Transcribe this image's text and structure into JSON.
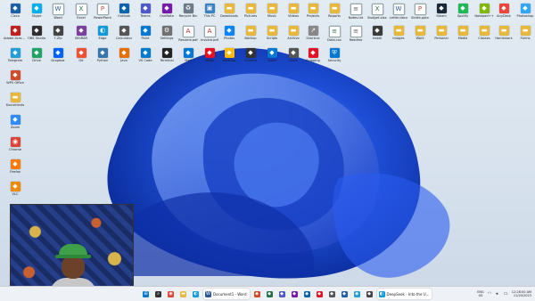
{
  "wallpaper": {
    "name": "Windows 11 Bloom",
    "primary": "#1e4fd8",
    "secondary": "#0b2c9a",
    "highlight": "#6aa0ff",
    "background": "#dde6f0"
  },
  "desktop_icons": [
    {
      "label": "Cisco",
      "icon": "app-icon",
      "kind": "exe",
      "color": "#1b5fa7"
    },
    {
      "label": "Adobe Acrobat",
      "icon": "app-icon",
      "kind": "exe",
      "color": "#c21f1f"
    },
    {
      "label": "Telegram",
      "icon": "app-icon",
      "kind": "exe",
      "color": "#229ed9"
    },
    {
      "label": "WPS Office",
      "icon": "app-icon",
      "kind": "exe",
      "color": "#d24b28"
    },
    {
      "label": "Documents",
      "icon": "folder-icon",
      "kind": "folder",
      "color": "#e8b83a"
    },
    {
      "label": "Zoom",
      "icon": "app-icon",
      "kind": "exe",
      "color": "#2d8cff"
    },
    {
      "label": "Chrome",
      "icon": "chrome-icon",
      "kind": "exe",
      "color": "#de4335"
    },
    {
      "label": "Firefox",
      "icon": "app-icon",
      "kind": "exe",
      "color": "#ff7a00"
    },
    {
      "label": "VLC",
      "icon": "app-icon",
      "kind": "exe",
      "color": "#f08a00"
    },
    {
      "label": "Skype",
      "icon": "app-icon",
      "kind": "exe",
      "color": "#00aff0"
    },
    {
      "label": "Word",
      "icon": "word-icon",
      "kind": "file",
      "color": "#2b579a"
    },
    {
      "label": "Excel",
      "icon": "excel-icon",
      "kind": "file",
      "color": "#217346"
    },
    {
      "label": "PowerPoint",
      "icon": "ppt-icon",
      "kind": "file",
      "color": "#d24726"
    },
    {
      "label": "Outlook",
      "icon": "app-icon",
      "kind": "exe",
      "color": "#0a64ad"
    },
    {
      "label": "Teams",
      "icon": "app-icon",
      "kind": "exe",
      "color": "#5059c9"
    },
    {
      "label": "OneNote",
      "icon": "app-icon",
      "kind": "exe",
      "color": "#7719aa"
    },
    {
      "label": "Recycle Bin",
      "icon": "recycle-bin-icon",
      "kind": "exe",
      "color": "#6d7a8a"
    },
    {
      "label": "This PC",
      "icon": "computer-icon",
      "kind": "exe",
      "color": "#3a82c4"
    },
    {
      "label": "Downloads",
      "icon": "folder-icon",
      "kind": "folder",
      "color": "#e8b83a"
    },
    {
      "label": "Pictures",
      "icon": "folder-icon",
      "kind": "folder",
      "color": "#e8b83a"
    },
    {
      "label": "Music",
      "icon": "folder-icon",
      "kind": "folder",
      "color": "#e8b83a"
    },
    {
      "label": "Videos",
      "icon": "folder-icon",
      "kind": "folder",
      "color": "#e8b83a"
    },
    {
      "label": "Projects",
      "icon": "folder-icon",
      "kind": "folder",
      "color": "#e8b83a"
    },
    {
      "label": "Reports",
      "icon": "folder-icon",
      "kind": "folder",
      "color": "#e8b83a"
    },
    {
      "label": "Notes.txt",
      "icon": "file-icon",
      "kind": "file",
      "color": "#5a5a5a"
    },
    {
      "label": "Budget.xlsx",
      "icon": "excel-icon",
      "kind": "file",
      "color": "#217346"
    },
    {
      "label": "Letter.docx",
      "icon": "word-icon",
      "kind": "file",
      "color": "#2b579a"
    },
    {
      "label": "Slides.pptx",
      "icon": "ppt-icon",
      "kind": "file",
      "color": "#d24726"
    },
    {
      "label": "Steam",
      "icon": "app-icon",
      "kind": "exe",
      "color": "#1b2838"
    },
    {
      "label": "Spotify",
      "icon": "app-icon",
      "kind": "exe",
      "color": "#1db954"
    },
    {
      "label": "Notepad++",
      "icon": "app-icon",
      "kind": "exe",
      "color": "#7fb900"
    },
    {
      "label": "AnyDesk",
      "icon": "app-icon",
      "kind": "exe",
      "color": "#ef443b"
    },
    {
      "label": "Photoshop",
      "icon": "app-icon",
      "kind": "exe",
      "color": "#31a8ff"
    },
    {
      "label": "OBS Studio",
      "icon": "app-icon",
      "kind": "exe",
      "color": "#302e31"
    },
    {
      "label": "7-Zip",
      "icon": "app-icon",
      "kind": "exe",
      "color": "#444"
    },
    {
      "label": "WinRAR",
      "icon": "app-icon",
      "kind": "exe",
      "color": "#7b3fa0"
    },
    {
      "label": "Edge",
      "icon": "edge-icon",
      "kind": "exe",
      "color": "#0c9bdb"
    },
    {
      "label": "Calculator",
      "icon": "app-icon",
      "kind": "exe",
      "color": "#555"
    },
    {
      "label": "Paint",
      "icon": "app-icon",
      "kind": "exe",
      "color": "#0078d4"
    },
    {
      "label": "Settings",
      "icon": "gear-icon",
      "kind": "exe",
      "color": "#707070"
    },
    {
      "label": "Resume.pdf",
      "icon": "pdf-icon",
      "kind": "file",
      "color": "#c21f1f"
    },
    {
      "label": "Invoice.pdf",
      "icon": "pdf-icon",
      "kind": "file",
      "color": "#c21f1f"
    },
    {
      "label": "Photos",
      "icon": "app-icon",
      "kind": "exe",
      "color": "#0a84ff"
    },
    {
      "label": "Backup",
      "icon": "folder-icon",
      "kind": "folder",
      "color": "#e8b83a"
    },
    {
      "label": "Scripts",
      "icon": "folder-icon",
      "kind": "folder",
      "color": "#e8b83a"
    },
    {
      "label": "Archive",
      "icon": "folder-icon",
      "kind": "folder",
      "color": "#e8b83a"
    },
    {
      "label": "Shortcut",
      "icon": "link-icon",
      "kind": "exe",
      "color": "#888"
    },
    {
      "label": "Data.csv",
      "icon": "file-icon",
      "kind": "file",
      "color": "#217346"
    },
    {
      "label": "Readme",
      "icon": "file-icon",
      "kind": "file",
      "color": "#5a5a5a"
    },
    {
      "label": "Install",
      "icon": "app-icon",
      "kind": "exe",
      "color": "#3b3b3b"
    },
    {
      "label": "Images",
      "icon": "folder-icon",
      "kind": "folder",
      "color": "#e8b83a"
    },
    {
      "label": "Work",
      "icon": "folder-icon",
      "kind": "folder",
      "color": "#e8b83a"
    },
    {
      "label": "Personal",
      "icon": "folder-icon",
      "kind": "folder",
      "color": "#e8b83a"
    },
    {
      "label": "Media",
      "icon": "folder-icon",
      "kind": "folder",
      "color": "#e8b83a"
    },
    {
      "label": "Classes",
      "icon": "folder-icon",
      "kind": "folder",
      "color": "#e8b83a"
    },
    {
      "label": "Homework",
      "icon": "folder-icon",
      "kind": "folder",
      "color": "#e8b83a"
    },
    {
      "label": "Forms",
      "icon": "folder-icon",
      "kind": "folder",
      "color": "#e8b83a"
    },
    {
      "label": "Drive",
      "icon": "app-icon",
      "kind": "exe",
      "color": "#1fa463"
    },
    {
      "label": "Dropbox",
      "icon": "app-icon",
      "kind": "exe",
      "color": "#0061ff"
    },
    {
      "label": "Git",
      "icon": "app-icon",
      "kind": "exe",
      "color": "#f05032"
    },
    {
      "label": "Python",
      "icon": "app-icon",
      "kind": "exe",
      "color": "#3776ab"
    },
    {
      "label": "Java",
      "icon": "app-icon",
      "kind": "exe",
      "color": "#e76f00"
    },
    {
      "label": "VS Code",
      "icon": "app-icon",
      "kind": "exe",
      "color": "#007acc"
    },
    {
      "label": "Terminal",
      "icon": "app-icon",
      "kind": "exe",
      "color": "#222"
    },
    {
      "label": "Mail",
      "icon": "app-icon",
      "kind": "exe",
      "color": "#0078d4"
    },
    {
      "label": "Maps",
      "icon": "app-icon",
      "kind": "exe",
      "color": "#e81123"
    },
    {
      "label": "Weather",
      "icon": "app-icon",
      "kind": "exe",
      "color": "#ffb900"
    },
    {
      "label": "Camera",
      "icon": "app-icon",
      "kind": "exe",
      "color": "#333"
    },
    {
      "label": "Store",
      "icon": "app-icon",
      "kind": "exe",
      "color": "#0078d4"
    },
    {
      "label": "Clock",
      "icon": "app-icon",
      "kind": "exe",
      "color": "#555"
    },
    {
      "label": "Snipping",
      "icon": "app-icon",
      "kind": "exe",
      "color": "#e81123"
    },
    {
      "label": "Security",
      "icon": "shield-icon",
      "kind": "exe",
      "color": "#0078d4"
    }
  ],
  "taskbar": {
    "search_icon": "search-icon",
    "apps": [
      {
        "name": "start",
        "icon": "windows-icon",
        "color": "#0078d4"
      },
      {
        "name": "search",
        "icon": "search-icon",
        "color": "#333"
      },
      {
        "name": "chrome",
        "icon": "chrome-icon",
        "color": "#de4335"
      },
      {
        "name": "explorer",
        "icon": "folder-icon",
        "color": "#e8b83a"
      },
      {
        "name": "edge",
        "icon": "edge-icon",
        "color": "#0c9bdb"
      }
    ],
    "windows": [
      {
        "label": "Document1 - Word",
        "icon": "word-icon",
        "color": "#2b579a"
      },
      {
        "label": "DeepSeek - Into the U...",
        "icon": "edge-icon",
        "color": "#0c9bdb"
      }
    ],
    "extra_apps": [
      {
        "icon": "app-icon",
        "color": "#d24726"
      },
      {
        "icon": "app-icon",
        "color": "#217346"
      },
      {
        "icon": "app-icon",
        "color": "#5059c9"
      },
      {
        "icon": "app-icon",
        "color": "#7719aa"
      },
      {
        "icon": "app-icon",
        "color": "#0a64ad"
      },
      {
        "icon": "app-icon",
        "color": "#e81123"
      },
      {
        "icon": "app-icon",
        "color": "#555"
      },
      {
        "icon": "app-icon",
        "color": "#1b5fa7"
      },
      {
        "icon": "app-icon",
        "color": "#229ed9"
      },
      {
        "icon": "app-icon",
        "color": "#444"
      }
    ],
    "tray": {
      "language": "ENG",
      "region": "US",
      "time": "12:28:00 AM",
      "date": "11/20/2023"
    }
  }
}
